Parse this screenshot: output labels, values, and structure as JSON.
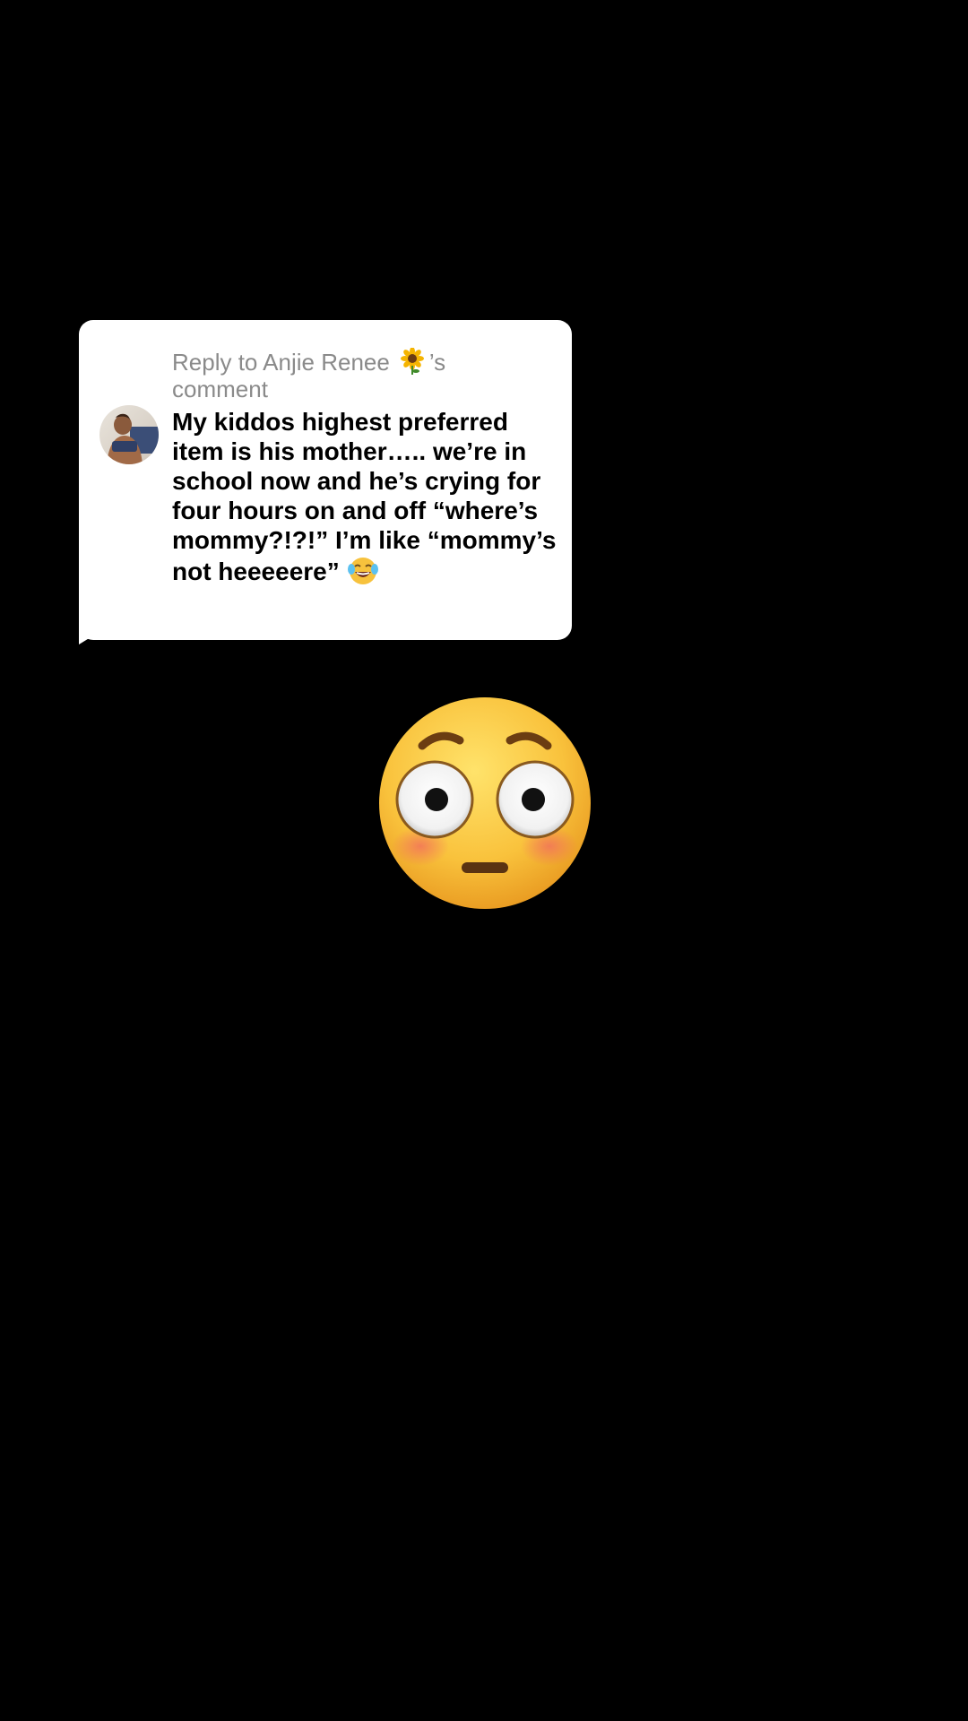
{
  "reply": {
    "prefix": "Reply to Anjie Renee",
    "suffix": "’s",
    "line2": "comment",
    "flower_icon": "sunflower-icon",
    "comment": "My kiddos highest preferred item is his mother….. we’re in school now and he’s crying for four hours on and off “where’s mommy?!?!” I’m like “mommy’s not heeeeere”",
    "laugh_icon": "face-with-tears-of-joy-icon",
    "avatar": "commenter-avatar"
  },
  "overlay": {
    "emoji": "flushed-face-icon"
  },
  "colors": {
    "background": "#000000",
    "bubble": "#ffffff",
    "header_text": "#8a8a8a",
    "comment_text": "#000000",
    "emoji_yellow": "#f7b733"
  }
}
